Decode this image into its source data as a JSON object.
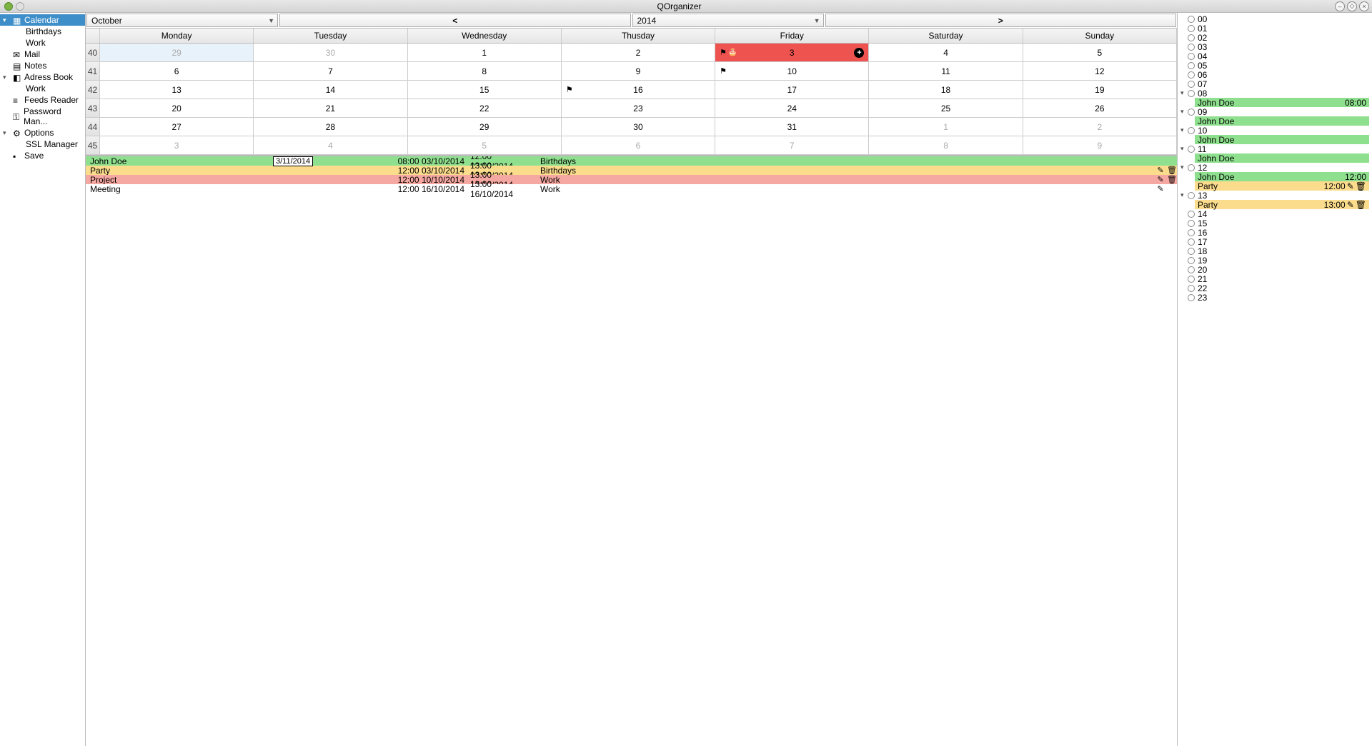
{
  "window": {
    "title": "QOrganizer"
  },
  "sidebar": {
    "items": [
      {
        "label": "Calendar",
        "icon": "calendar",
        "sel": true,
        "expand": true
      },
      {
        "label": "Birthdays",
        "nested": true
      },
      {
        "label": "Work",
        "nested": true
      },
      {
        "label": "Mail",
        "icon": "mail"
      },
      {
        "label": "Notes",
        "icon": "notes"
      },
      {
        "label": "Adress Book",
        "icon": "book",
        "expand": true
      },
      {
        "label": "Work",
        "nested": true
      },
      {
        "label": "Feeds Reader",
        "icon": "feed"
      },
      {
        "label": "Password Man...",
        "icon": "key"
      },
      {
        "label": "Options",
        "icon": "gear",
        "expand": true
      },
      {
        "label": "SSL Manager",
        "nested": true
      },
      {
        "label": "Save",
        "icon": "save",
        "nested": false
      }
    ]
  },
  "toolbar": {
    "month": "October",
    "prev": "<",
    "year": "2014",
    "next": ">"
  },
  "days": [
    "Monday",
    "Tuesday",
    "Wednesday",
    "Thusday",
    "Friday",
    "Saturday",
    "Sunday"
  ],
  "weeks": [
    {
      "wk": "40",
      "cells": [
        {
          "n": "29",
          "dim": true,
          "today": true
        },
        {
          "n": "30",
          "dim": true
        },
        {
          "n": "1"
        },
        {
          "n": "2"
        },
        {
          "n": "3",
          "sel": true,
          "flag": true,
          "cake": true,
          "add": true
        },
        {
          "n": "4"
        },
        {
          "n": "5"
        }
      ]
    },
    {
      "wk": "41",
      "cells": [
        {
          "n": "6"
        },
        {
          "n": "7"
        },
        {
          "n": "8"
        },
        {
          "n": "9"
        },
        {
          "n": "10",
          "flag": true
        },
        {
          "n": "11"
        },
        {
          "n": "12"
        }
      ]
    },
    {
      "wk": "42",
      "cells": [
        {
          "n": "13"
        },
        {
          "n": "14"
        },
        {
          "n": "15"
        },
        {
          "n": "16",
          "flag": true
        },
        {
          "n": "17"
        },
        {
          "n": "18"
        },
        {
          "n": "19"
        }
      ]
    },
    {
      "wk": "43",
      "cells": [
        {
          "n": "20"
        },
        {
          "n": "21"
        },
        {
          "n": "22"
        },
        {
          "n": "23"
        },
        {
          "n": "24"
        },
        {
          "n": "25"
        },
        {
          "n": "26"
        }
      ]
    },
    {
      "wk": "44",
      "cells": [
        {
          "n": "27"
        },
        {
          "n": "28"
        },
        {
          "n": "29"
        },
        {
          "n": "30"
        },
        {
          "n": "31"
        },
        {
          "n": "1",
          "dim": true
        },
        {
          "n": "2",
          "dim": true
        }
      ]
    },
    {
      "wk": "45",
      "cells": [
        {
          "n": "3",
          "dim": true
        },
        {
          "n": "4",
          "dim": true
        },
        {
          "n": "5",
          "dim": true
        },
        {
          "n": "6",
          "dim": true
        },
        {
          "n": "7",
          "dim": true
        },
        {
          "n": "8",
          "dim": true
        },
        {
          "n": "9",
          "dim": true
        }
      ]
    }
  ],
  "date_badge": "3/11/2014",
  "events": [
    {
      "title": "John Doe",
      "start": "08:00 03/10/2014",
      "end": "12:00 03/10/2014",
      "cat": "Birthdays",
      "cls": "ev-green",
      "edit": false,
      "del": false
    },
    {
      "title": "Party",
      "start": "12:00 03/10/2014",
      "end": "13:00 03/10/2014",
      "cat": "Birthdays",
      "cls": "ev-yellow",
      "edit": true,
      "del": true
    },
    {
      "title": "Project",
      "start": "12:00 10/10/2014",
      "end": "13:00 10/10/2014",
      "cat": "Work",
      "cls": "ev-red",
      "edit": true,
      "del": true
    },
    {
      "title": "Meeting",
      "start": "12:00 16/10/2014",
      "end": "13:00 16/10/2014",
      "cat": "Work",
      "cls": "ev-plain",
      "edit": true,
      "del": false
    }
  ],
  "timeline": [
    {
      "type": "h",
      "label": "00"
    },
    {
      "type": "h",
      "label": "01"
    },
    {
      "type": "h",
      "label": "02"
    },
    {
      "type": "h",
      "label": "03"
    },
    {
      "type": "h",
      "label": "04"
    },
    {
      "type": "h",
      "label": "05"
    },
    {
      "type": "h",
      "label": "06"
    },
    {
      "type": "h",
      "label": "07"
    },
    {
      "type": "h",
      "label": "08",
      "expand": true
    },
    {
      "type": "e",
      "label": "John Doe",
      "time": "08:00",
      "cls": "green"
    },
    {
      "type": "h",
      "label": "09",
      "expand": true
    },
    {
      "type": "e",
      "label": "John Doe",
      "time": "",
      "cls": "green"
    },
    {
      "type": "h",
      "label": "10",
      "expand": true
    },
    {
      "type": "e",
      "label": "John Doe",
      "time": "",
      "cls": "green"
    },
    {
      "type": "h",
      "label": "11",
      "expand": true
    },
    {
      "type": "e",
      "label": "John Doe",
      "time": "",
      "cls": "green"
    },
    {
      "type": "h",
      "label": "12",
      "expand": true
    },
    {
      "type": "e",
      "label": "John Doe",
      "time": "12:00",
      "cls": "green"
    },
    {
      "type": "e",
      "label": "Party",
      "time": "12:00",
      "cls": "yellow",
      "edit": true,
      "del": true
    },
    {
      "type": "h",
      "label": "13",
      "expand": true
    },
    {
      "type": "e",
      "label": "Party",
      "time": "13:00",
      "cls": "yellow",
      "edit": true,
      "del": true
    },
    {
      "type": "h",
      "label": "14"
    },
    {
      "type": "h",
      "label": "15"
    },
    {
      "type": "h",
      "label": "16"
    },
    {
      "type": "h",
      "label": "17"
    },
    {
      "type": "h",
      "label": "18"
    },
    {
      "type": "h",
      "label": "19"
    },
    {
      "type": "h",
      "label": "20"
    },
    {
      "type": "h",
      "label": "21"
    },
    {
      "type": "h",
      "label": "22"
    },
    {
      "type": "h",
      "label": "23"
    }
  ]
}
